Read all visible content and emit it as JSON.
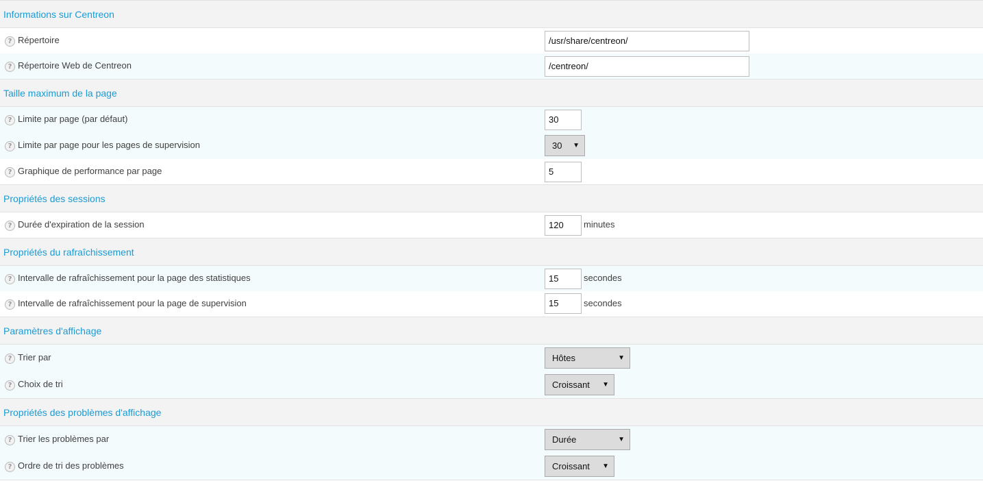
{
  "sections": {
    "info": {
      "title": "Informations sur Centreon",
      "repertoire": {
        "label": "Répertoire",
        "value": "/usr/share/centreon/"
      },
      "web_repertoire": {
        "label": "Répertoire Web de Centreon",
        "value": "/centreon/"
      }
    },
    "page_size": {
      "title": "Taille maximum de la page",
      "limit_default": {
        "label": "Limite par page (par défaut)",
        "value": "30"
      },
      "limit_supervision": {
        "label": "Limite par page pour les pages de supervision",
        "value": "30"
      },
      "perf_graphs": {
        "label": "Graphique de performance par page",
        "value": "5"
      }
    },
    "sessions": {
      "title": "Propriétés des sessions",
      "expiration": {
        "label": "Durée d'expiration de la session",
        "value": "120",
        "unit": "minutes"
      }
    },
    "refresh": {
      "title": "Propriétés du rafraîchissement",
      "stats": {
        "label": "Intervalle de rafraîchissement pour la page des statistiques",
        "value": "15",
        "unit": "secondes"
      },
      "supervision": {
        "label": "Intervalle de rafraîchissement pour la page de supervision",
        "value": "15",
        "unit": "secondes"
      }
    },
    "display": {
      "title": "Paramètres d'affichage",
      "sort_by": {
        "label": "Trier par",
        "value": "Hôtes"
      },
      "sort_order": {
        "label": "Choix de tri",
        "value": "Croissant"
      }
    },
    "problems": {
      "title": "Propriétés des problèmes d'affichage",
      "sort_by": {
        "label": "Trier les problèmes par",
        "value": "Durée"
      },
      "sort_order": {
        "label": "Ordre de tri des problèmes",
        "value": "Croissant"
      }
    }
  },
  "icons": {
    "help": "help-icon",
    "dropdown": "chevron-down-icon"
  },
  "help_glyph": "?",
  "dropdown_glyph": "▼",
  "colors": {
    "section_title": "#1b9bd5",
    "header_bg": "#f3f3f3",
    "alt_row_bg": "#f4fbfd"
  }
}
